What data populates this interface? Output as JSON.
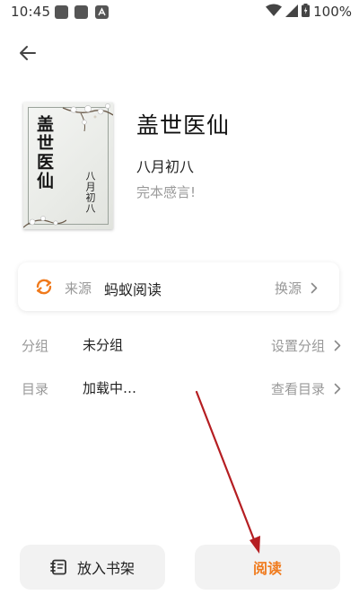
{
  "status_bar": {
    "time": "10:45",
    "battery": "100%"
  },
  "book": {
    "cover_title": "盖世医仙",
    "cover_author": "八月初八",
    "title": "盖世医仙",
    "author": "八月初八",
    "status": "完本感言!"
  },
  "source": {
    "label": "来源",
    "value": "蚂蚁阅读",
    "action": "换源"
  },
  "group": {
    "label": "分组",
    "value": "未分组",
    "action": "设置分组"
  },
  "toc": {
    "label": "目录",
    "value": "加载中…",
    "action": "查看目录"
  },
  "buttons": {
    "add_to_shelf": "放入书架",
    "read": "阅读"
  },
  "colors": {
    "accent": "#f07a1c",
    "annotation_arrow": "#b51e22"
  }
}
